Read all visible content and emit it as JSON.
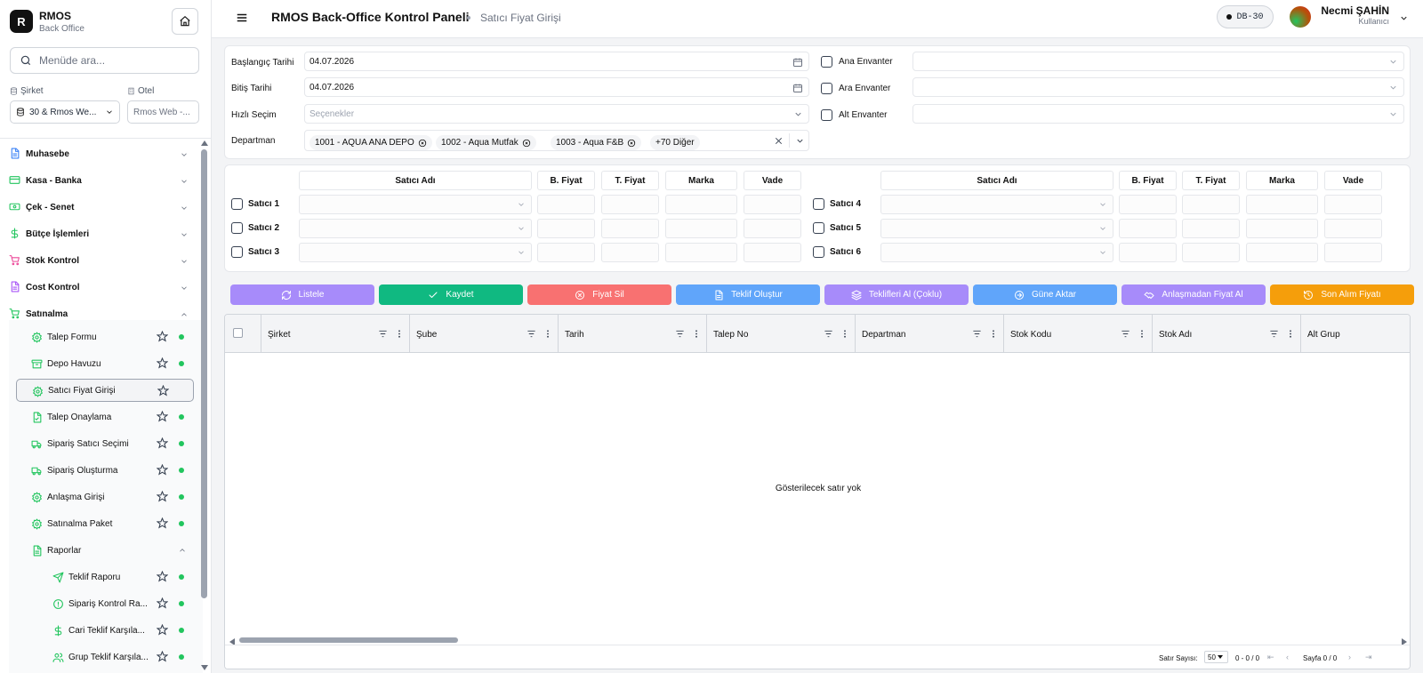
{
  "app": {
    "brand_letter": "R",
    "brand_title": "RMOS",
    "brand_subtitle": "Back Office"
  },
  "sidebar": {
    "search_placeholder": "Menüde ara...",
    "company_label": "Şirket",
    "company_value": "30 & Rmos We...",
    "hotel_label": "Otel",
    "hotel_value": "Rmos Web -...",
    "menu": [
      {
        "label": "Muhasebe",
        "icon": "document-icon",
        "color": "#3b82f6"
      },
      {
        "label": "Kasa - Banka",
        "icon": "card-icon",
        "color": "#22c55e"
      },
      {
        "label": "Çek - Senet",
        "icon": "banknote-icon",
        "color": "#22c55e"
      },
      {
        "label": "Bütçe İşlemleri",
        "icon": "dollar-icon",
        "color": "#22c55e"
      },
      {
        "label": "Stok Kontrol",
        "icon": "cart-icon",
        "color": "#ec4899"
      },
      {
        "label": "Cost Kontrol",
        "icon": "document-icon",
        "color": "#a855f7"
      },
      {
        "label": "Satınalma",
        "icon": "cart-icon",
        "color": "#22c55e"
      }
    ],
    "satinalma_items": [
      {
        "label": "Talep Formu",
        "icon": "gear-icon"
      },
      {
        "label": "Depo Havuzu",
        "icon": "archive-icon"
      },
      {
        "label": "Satıcı Fiyat Girişi",
        "icon": "gear-icon"
      },
      {
        "label": "Talep Onaylama",
        "icon": "file-check-icon"
      },
      {
        "label": "Sipariş Satıcı Seçimi",
        "icon": "truck-icon"
      },
      {
        "label": "Sipariş Oluşturma",
        "icon": "truck-icon"
      },
      {
        "label": "Anlaşma Girişi",
        "icon": "gear-icon"
      },
      {
        "label": "Satınalma Paket",
        "icon": "gear-icon"
      }
    ],
    "raporlar_label": "Raporlar",
    "rapor_items": [
      {
        "label": "Teklif Raporu",
        "icon": "send-icon"
      },
      {
        "label": "Sipariş Kontrol Ra...",
        "icon": "info-icon"
      },
      {
        "label": "Cari Teklif Karşıla...",
        "icon": "dollar-icon"
      },
      {
        "label": "Grup Teklif Karşıla...",
        "icon": "users-icon"
      }
    ]
  },
  "header": {
    "title": "RMOS Back-Office Kontrol Paneli",
    "subtitle": "Satıcı Fiyat Girişi",
    "db_badge": "DB-30",
    "user_name": "Necmi ŞAHİN",
    "user_role": "Kullanıcı"
  },
  "filters": {
    "start_label": "Başlangıç Tarihi",
    "start_value": "04.07.2026",
    "end_label": "Bitiş Tarihi",
    "end_value": "04.07.2026",
    "quick_label": "Hızlı Seçim",
    "quick_placeholder": "Seçenekler",
    "dept_label": "Departman",
    "dept_tags": [
      "1001 - AQUA ANA DEPO",
      "1002 - Aqua Mutfak",
      "1003 - Aqua F&B"
    ],
    "dept_more": "+70 Diğer",
    "inventory": [
      "Ana Envanter",
      "Ara Envanter",
      "Alt Envanter"
    ]
  },
  "vendors": {
    "headers": [
      "Satıcı Adı",
      "B. Fiyat",
      "T. Fiyat",
      "Marka",
      "Vade"
    ],
    "left": [
      "Satıcı 1",
      "Satıcı 2",
      "Satıcı 3"
    ],
    "right": [
      "Satıcı 4",
      "Satıcı 5",
      "Satıcı 6"
    ]
  },
  "actions": [
    {
      "label": "Listele",
      "color": "#a78bfa",
      "icon": "refresh-icon"
    },
    {
      "label": "Kaydet",
      "color": "#10b981",
      "icon": "check-icon"
    },
    {
      "label": "Fiyat Sil",
      "color": "#f87171",
      "icon": "x-circle-icon"
    },
    {
      "label": "Teklif Oluştur",
      "color": "#60a5fa",
      "icon": "document-icon"
    },
    {
      "label": "Teklifleri Al (Çoklu)",
      "color": "#a78bfa",
      "icon": "layers-icon"
    },
    {
      "label": "Güne Aktar",
      "color": "#60a5fa",
      "icon": "arrow-circle-icon"
    },
    {
      "label": "Anlaşmadan Fiyat Al",
      "color": "#a78bfa",
      "icon": "handshake-icon"
    },
    {
      "label": "Son Alım Fiyatı",
      "color": "#f59e0b",
      "icon": "history-icon"
    }
  ],
  "grid": {
    "columns": [
      "Şirket",
      "Şube",
      "Tarih",
      "Talep No",
      "Departman",
      "Stok Kodu",
      "Stok Adı",
      "Alt Grup"
    ],
    "empty_text": "Gösterilecek satır yok",
    "rows_label": "Satır Sayısı:",
    "page_size": "50",
    "range": "0 - 0 / 0",
    "page_text": "Sayfa 0 / 0"
  }
}
